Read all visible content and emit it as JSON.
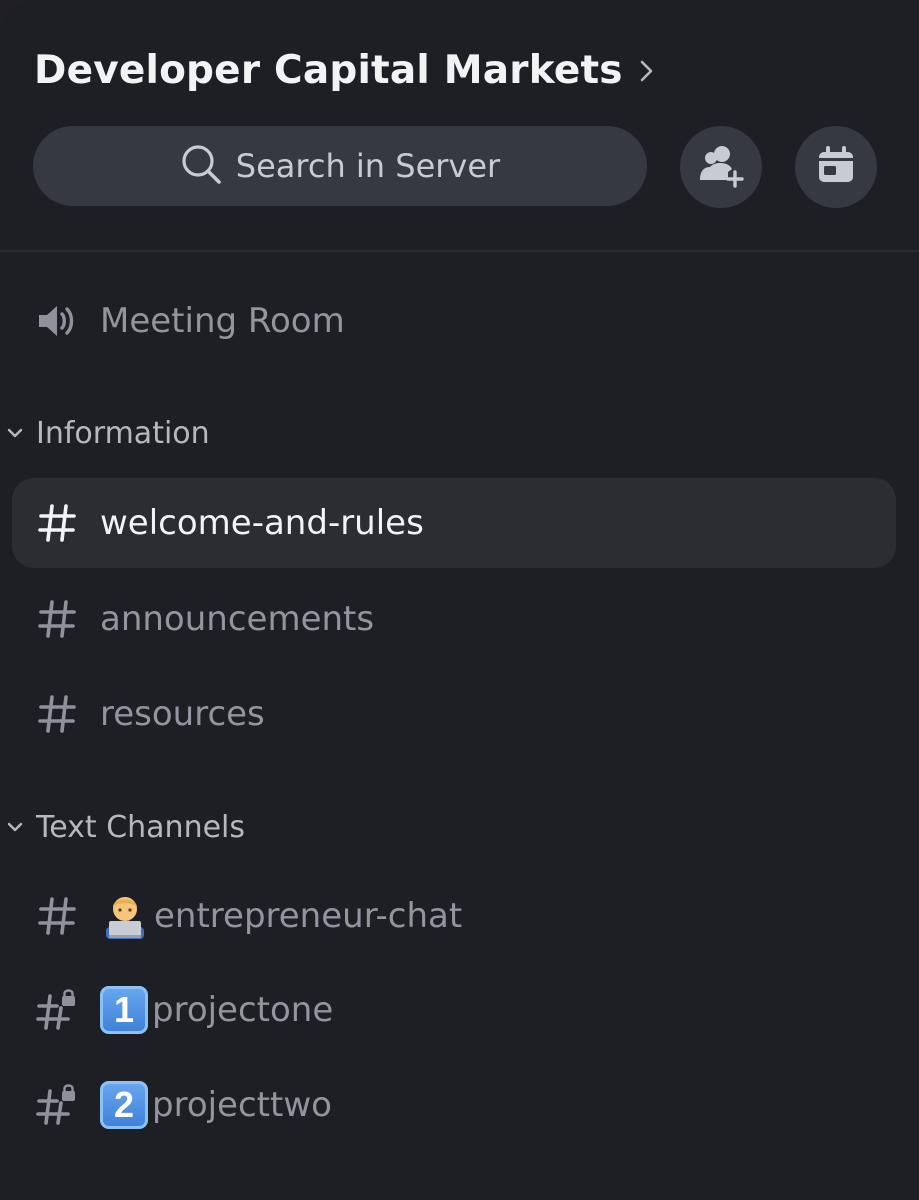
{
  "server": {
    "name": "Developer Capital Markets",
    "chevron_icon": "chevron-right-icon"
  },
  "search": {
    "label": "Search in Server",
    "icon": "search-icon"
  },
  "actions": {
    "invite_icon": "add-member-icon",
    "events_icon": "calendar-icon"
  },
  "voice_channels": [
    {
      "label": "Meeting Room",
      "icon": "speaker-icon"
    }
  ],
  "categories": [
    {
      "label": "Information",
      "channels": [
        {
          "label": "welcome-and-rules",
          "icon": "hash-icon",
          "selected": true
        },
        {
          "label": "announcements",
          "icon": "hash-icon"
        },
        {
          "label": "resources",
          "icon": "hash-icon"
        }
      ]
    },
    {
      "label": "Text Channels",
      "channels": [
        {
          "label": "entrepreneur-chat",
          "icon": "hash-icon",
          "emoji": "technologist-emoji"
        },
        {
          "label": "projectone",
          "icon": "locked-hash-icon",
          "emoji": "keycap-one",
          "emoji_text": "1"
        },
        {
          "label": "projecttwo",
          "icon": "locked-hash-icon",
          "emoji": "keycap-two",
          "emoji_text": "2"
        }
      ]
    }
  ],
  "colors": {
    "background": "#1e1f24",
    "selected_row": "#2c2d33",
    "text_primary": "#f2f3f5",
    "text_muted": "#92959f",
    "button_bg": "#363842"
  }
}
